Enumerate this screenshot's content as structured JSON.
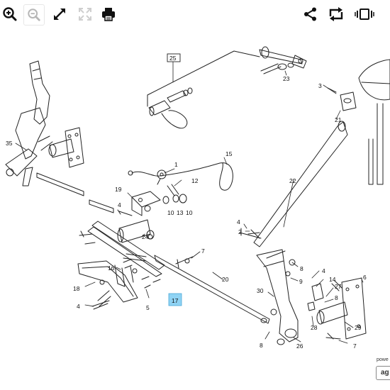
{
  "toolbar": {
    "left": [
      {
        "icon": "zoom-in-icon",
        "enabled": true
      },
      {
        "icon": "zoom-out-icon",
        "enabled": false
      },
      {
        "icon": "expand-icon",
        "enabled": true
      },
      {
        "icon": "fit-icon",
        "enabled": false
      },
      {
        "icon": "print-icon",
        "enabled": true
      }
    ],
    "right": [
      {
        "icon": "share-icon"
      },
      {
        "icon": "rotate-icon"
      },
      {
        "icon": "carousel-icon"
      }
    ]
  },
  "diagram": {
    "callouts": {
      "c1": "1",
      "c2": "2",
      "c3": "3",
      "c4a": "4",
      "c4b": "4",
      "c4c": "4",
      "c4d": "4",
      "c5": "5",
      "c6": "6",
      "c7a": "7",
      "c7b": "7",
      "c8a": "8",
      "c8b": "8",
      "c8c": "8",
      "c9": "9",
      "c10a": "10",
      "c10b": "10",
      "c12": "12",
      "c13": "13",
      "c14": "14",
      "c15": "15",
      "c16": "16",
      "c18": "18",
      "c19": "19",
      "c20": "20",
      "c21": "21",
      "c22": "22",
      "c23": "23",
      "c24": "24",
      "c25": "25",
      "c26": "26",
      "c27": "27",
      "c28": "28",
      "c29": "29",
      "c30": "30",
      "c35": "35",
      "c17": "17"
    }
  },
  "footer": {
    "label": "powe",
    "logo": "ag"
  }
}
